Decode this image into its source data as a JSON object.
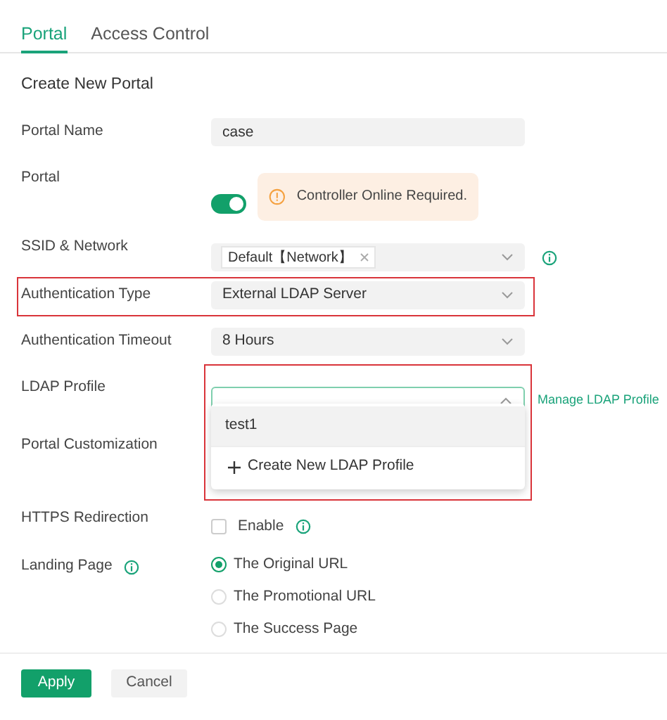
{
  "tabs": [
    {
      "label": "Portal",
      "selected": true
    },
    {
      "label": "Access Control",
      "selected": false
    }
  ],
  "title": "Create New Portal",
  "fields": [
    {
      "kind": "text",
      "label": "Portal Name",
      "value": "case"
    },
    {
      "kind": "toggle",
      "label": "Portal",
      "on": true,
      "alert": "Controller Online Required."
    },
    {
      "kind": "tags",
      "label": "SSID & Network",
      "tags": [
        "Default【Network】"
      ]
    },
    {
      "kind": "select",
      "label": "Authentication Type",
      "value": "External LDAP Server",
      "highlighted": true
    },
    {
      "kind": "select",
      "label": "Authentication Timeout",
      "value": "8 Hours",
      "highlighted": false
    },
    {
      "kind": "dropdown",
      "label": "LDAP Profile",
      "link": "Manage LDAP Profile",
      "expanded": true,
      "highlighted": true,
      "options": [
        {
          "label": "test1",
          "hovered": true
        }
      ],
      "create": "Create New LDAP Profile"
    },
    {
      "kind": "empty",
      "label": "Portal Customization"
    },
    {
      "kind": "checkbox",
      "label": "HTTPS Redirection",
      "text": "Enable",
      "checked": false
    },
    {
      "kind": "radio",
      "label": "Landing Page",
      "options": [
        {
          "label": "The Original URL",
          "selected": true
        },
        {
          "label": "The Promotional URL",
          "selected": false
        },
        {
          "label": "The Success Page",
          "selected": false
        }
      ]
    }
  ],
  "buttons": {
    "apply": "Apply",
    "cancel": "Cancel"
  }
}
